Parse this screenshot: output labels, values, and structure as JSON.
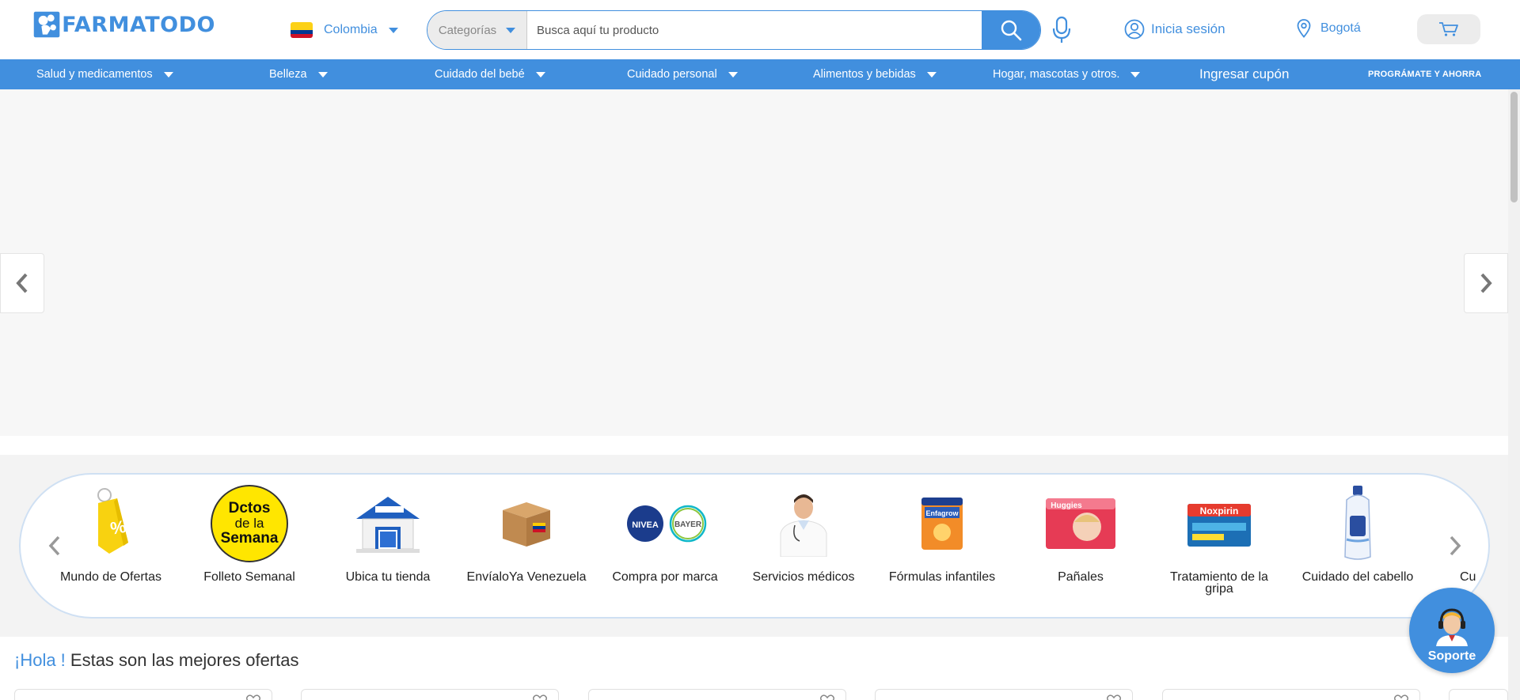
{
  "header": {
    "logo_text": "FARMATODO",
    "country": "Colombia",
    "search": {
      "category_label": "Categorías",
      "placeholder": "Busca aquí tu producto"
    },
    "login_label": "Inicia sesión",
    "location_label": "Bogotá"
  },
  "nav": {
    "items": [
      {
        "label": "Salud y medicamentos"
      },
      {
        "label": "Belleza"
      },
      {
        "label": "Cuidado del bebé"
      },
      {
        "label": "Cuidado personal"
      },
      {
        "label": "Alimentos y bebidas"
      },
      {
        "label": "Hogar, mascotas y otros."
      }
    ],
    "coupon": "Ingresar cupón",
    "program": "PROGRÁMATE Y AHORRA"
  },
  "categories": {
    "items": [
      {
        "label": "Mundo de Ofertas",
        "icon": "price-tag-icon"
      },
      {
        "label": "Folleto Semanal",
        "icon": "weekly-flyer-icon"
      },
      {
        "label": "Ubica tu tienda",
        "icon": "store-icon"
      },
      {
        "label": "EnvíaloYa Venezuela",
        "icon": "package-icon"
      },
      {
        "label": "Compra por marca",
        "icon": "brand-logos-icon"
      },
      {
        "label": "Servicios médicos",
        "icon": "doctor-icon"
      },
      {
        "label": "Fórmulas infantiles",
        "icon": "formula-can-icon"
      },
      {
        "label": "Pañales",
        "icon": "diapers-icon"
      },
      {
        "label": "Tratamiento de la gripa",
        "icon": "flu-medicine-icon"
      },
      {
        "label": "Cuidado del cabello",
        "icon": "shampoo-icon"
      },
      {
        "label": "Cu",
        "icon": ""
      }
    ],
    "flyer_badge": "Dctos de la Semana",
    "brand_logos": [
      "NIVEA",
      "BAYER"
    ],
    "formula_brand": "Enfagrow",
    "diaper_brand": "Huggies",
    "flu_brand": "Noxpirin"
  },
  "offers": {
    "hola": "¡Hola !",
    "title": " Estas son las mejores ofertas"
  },
  "support": {
    "label": "Soporte"
  },
  "colors": {
    "brand": "#418fde",
    "flag": [
      "#fcd116",
      "#003893",
      "#ce1126"
    ]
  }
}
